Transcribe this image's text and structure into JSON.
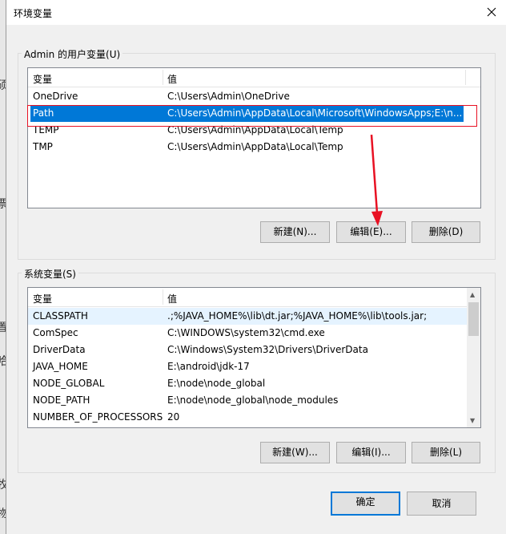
{
  "window": {
    "title": "环境变量"
  },
  "left_strip_chars": [
    "硕",
    "票",
    "置",
    "哈",
    "牧",
    "物"
  ],
  "user_vars": {
    "group_label": "Admin 的用户变量(U)",
    "header": {
      "col1": "变量",
      "col2": "值"
    },
    "rows": [
      {
        "name": "OneDrive",
        "value": "C:\\Users\\Admin\\OneDrive"
      },
      {
        "name": "Path",
        "value": "C:\\Users\\Admin\\AppData\\Local\\Microsoft\\WindowsApps;E:\\n..."
      },
      {
        "name": "TEMP",
        "value": "C:\\Users\\Admin\\AppData\\Local\\Temp"
      },
      {
        "name": "TMP",
        "value": "C:\\Users\\Admin\\AppData\\Local\\Temp"
      }
    ],
    "selected_index": 1,
    "buttons": {
      "new": "新建(N)...",
      "edit": "编辑(E)...",
      "delete": "删除(D)"
    }
  },
  "system_vars": {
    "group_label": "系统变量(S)",
    "header": {
      "col1": "变量",
      "col2": "值"
    },
    "rows": [
      {
        "name": "CLASSPATH",
        "value": ".;%JAVA_HOME%\\lib\\dt.jar;%JAVA_HOME%\\lib\\tools.jar;"
      },
      {
        "name": "ComSpec",
        "value": "C:\\WINDOWS\\system32\\cmd.exe"
      },
      {
        "name": "DriverData",
        "value": "C:\\Windows\\System32\\Drivers\\DriverData"
      },
      {
        "name": "JAVA_HOME",
        "value": "E:\\android\\jdk-17"
      },
      {
        "name": "NODE_GLOBAL",
        "value": "E:\\node\\node_global"
      },
      {
        "name": "NODE_PATH",
        "value": "E:\\node\\node_global\\node_modules"
      },
      {
        "name": "NUMBER_OF_PROCESSORS",
        "value": "20"
      }
    ],
    "buttons": {
      "new": "新建(W)...",
      "edit": "编辑(I)...",
      "delete": "删除(L)"
    }
  },
  "footer": {
    "ok": "确定",
    "cancel": "取消"
  },
  "colors": {
    "selection": "#0078d7",
    "annotation": "#e81123",
    "hover": "#e5f3ff"
  }
}
